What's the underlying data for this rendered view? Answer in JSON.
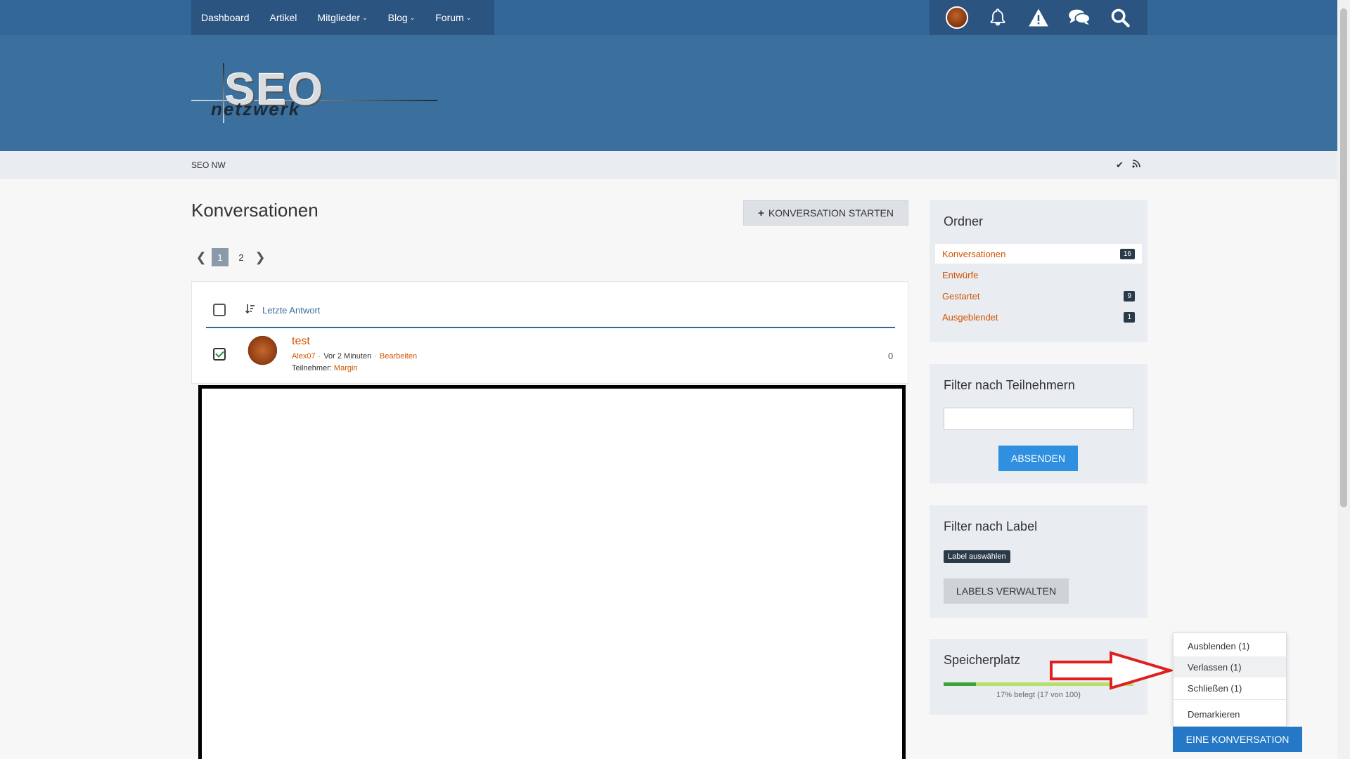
{
  "nav": {
    "items": [
      {
        "label": "Dashboard",
        "dropdown": false
      },
      {
        "label": "Artikel",
        "dropdown": false
      },
      {
        "label": "Mitglieder",
        "dropdown": true
      },
      {
        "label": "Blog",
        "dropdown": true
      },
      {
        "label": "Forum",
        "dropdown": true
      }
    ]
  },
  "usernav": {
    "icons": [
      "user-avatar",
      "bell-icon",
      "warning-icon",
      "chat-icon",
      "search-icon"
    ]
  },
  "breadcrumb": {
    "label": "SEO NW"
  },
  "logo": {
    "line1": "SEO",
    "line2": "netzwerk"
  },
  "main": {
    "title": "Konversationen",
    "start_button": "KONVERSATION STARTEN",
    "pages": [
      "1",
      "2"
    ],
    "current_page": "1",
    "sort_label": "Letzte Antwort",
    "rows": [
      {
        "title": "test",
        "author": "Alex07",
        "time": "Vor 2 Minuten",
        "edit": "Bearbeiten",
        "participants_label": "Teilnehmer:",
        "participant": "Margin",
        "replies": "0",
        "checked": true
      }
    ]
  },
  "sidebar": {
    "folders": {
      "title": "Ordner",
      "items": [
        {
          "label": "Konversationen",
          "count": "16",
          "active": true
        },
        {
          "label": "Entwürfe",
          "count": ""
        },
        {
          "label": "Gestartet",
          "count": "9"
        },
        {
          "label": "Ausgeblendet",
          "count": "1"
        }
      ]
    },
    "participant_filter": {
      "title": "Filter nach Teilnehmern",
      "input_value": "",
      "submit": "ABSENDEN"
    },
    "label_filter": {
      "title": "Filter nach Label",
      "chip": "Label auswählen",
      "manage": "LABELS VERWALTEN"
    },
    "storage": {
      "title": "Speicherplatz",
      "percent": 17,
      "text": "17% belegt (17 von 100)"
    }
  },
  "popup": {
    "items": [
      "Ausblenden (1)",
      "Verlassen (1)",
      "Schließen (1)"
    ],
    "unmark": "Demarkieren",
    "action": "EINE KONVERSATION"
  },
  "colors": {
    "nav_bg": "#2b5580",
    "header_bg": "#3b6f9e",
    "link": "#d35400",
    "accent": "#2478c6"
  }
}
